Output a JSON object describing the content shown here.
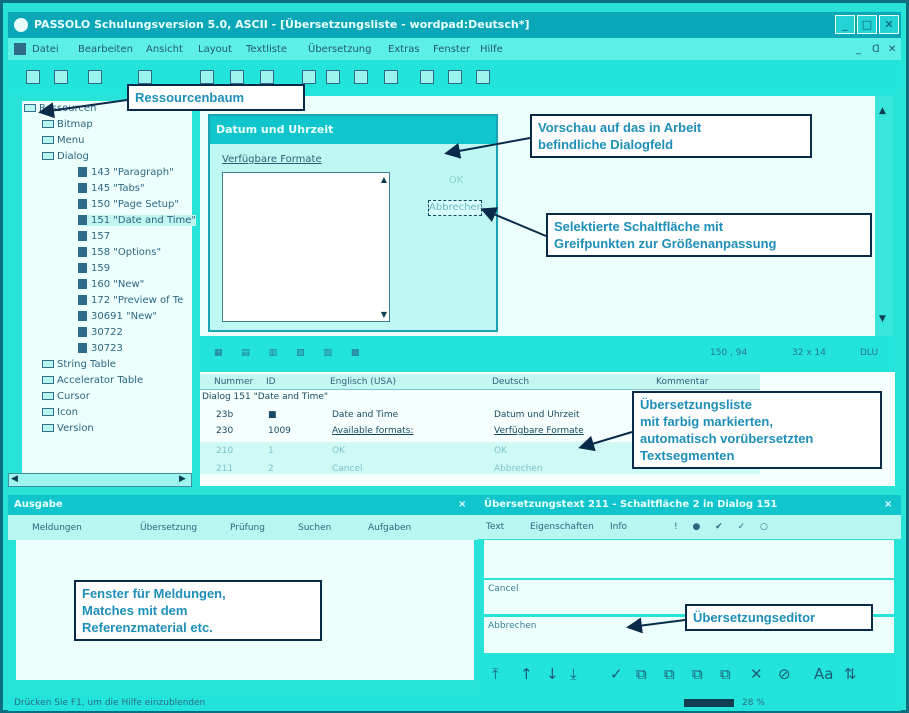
{
  "window": {
    "title": "PASSOLO Schulungsversion 5.0, ASCII - [Übersetzungsliste - wordpad:Deutsch*]"
  },
  "menu": [
    "Datei",
    "Bearbeiten",
    "Ansicht",
    "Layout",
    "Textliste",
    "Übersetzung",
    "Extras",
    "Fenster",
    "Hilfe"
  ],
  "tree": {
    "root": "Ressourcen",
    "items": [
      {
        "label": "Bitmap",
        "icon": "folder-icon"
      },
      {
        "label": "Menu",
        "icon": "folder-icon"
      },
      {
        "label": "Dialog",
        "icon": "folder-icon"
      },
      {
        "label": "143 \"Paragraph\"",
        "icon": "dialog-icon"
      },
      {
        "label": "145 \"Tabs\"",
        "icon": "dialog-icon"
      },
      {
        "label": "150 \"Page Setup\"",
        "icon": "dialog-icon"
      },
      {
        "label": "151 \"Date and Time\"",
        "icon": "dialog-icon"
      },
      {
        "label": "157",
        "icon": "dialog-icon"
      },
      {
        "label": "158 \"Options\"",
        "icon": "dialog-icon"
      },
      {
        "label": "159",
        "icon": "dialog-icon"
      },
      {
        "label": "160 \"New\"",
        "icon": "dialog-icon"
      },
      {
        "label": "172 \"Preview of Te",
        "icon": "dialog-icon"
      },
      {
        "label": "30691 \"New\"",
        "icon": "dialog-icon"
      },
      {
        "label": "30722",
        "icon": "dialog-icon"
      },
      {
        "label": "30723",
        "icon": "dialog-icon"
      },
      {
        "label": "String Table",
        "icon": "folder-icon"
      },
      {
        "label": "Accelerator Table",
        "icon": "folder-icon"
      },
      {
        "label": "Cursor",
        "icon": "folder-icon"
      },
      {
        "label": "Icon",
        "icon": "folder-icon"
      },
      {
        "label": "Version",
        "icon": "folder-icon"
      }
    ]
  },
  "preview": {
    "dialog_title": "Datum und Uhrzeit",
    "formats_label": "Verfügbare Formate",
    "ok_label": "OK",
    "cancel_label": "Abbrechen",
    "status": [
      "150 , 94",
      "32 x 14",
      "DLU"
    ]
  },
  "grid": {
    "headers": [
      "Nummer",
      "ID",
      "Englisch (USA)",
      "Deutsch",
      "Kommentar"
    ],
    "group": "Dialog 151 \"Date and Time\"",
    "rows": [
      {
        "nr": "23b",
        "id": "■",
        "en": "Date and Time",
        "de": "Datum und Uhrzeit"
      },
      {
        "nr": "230",
        "id": "1009",
        "en": "Available formats:",
        "de": "Verfügbare Formate"
      },
      {
        "nr": "210",
        "id": "1",
        "en": "OK",
        "de": "OK"
      },
      {
        "nr": "211",
        "id": "2",
        "en": "Cancel",
        "de": "Abbrechen"
      }
    ]
  },
  "output": {
    "title": "Ausgabe",
    "tabs": [
      "Meldungen",
      "Übersetzung",
      "Prüfung",
      "Suchen",
      "Aufgaben"
    ]
  },
  "editor": {
    "title": "Übersetzungstext 211 - Schaltfläche 2 in Dialog 151",
    "tabs": [
      "Text",
      "Eigenschaften",
      "Info"
    ],
    "original_label": "Cancel",
    "translation_label": "Abbrechen"
  },
  "statusbar": "Drücken Sie F1, um die Hilfe einzublenden",
  "statusbar_right": "28 %",
  "callouts": {
    "resource_tree": "Ressourcenbaum",
    "preview": [
      "Vorschau auf das in Arbeit",
      "befindliche Dialogfeld"
    ],
    "selected": [
      "Selektierte Schaltfläche mit",
      "Greifpunkten zur Größenanpassung"
    ],
    "list": [
      "Übersetzungsliste",
      "mit farbig markierten,",
      "automatisch vorübersetzten",
      "Textsegmenten"
    ],
    "messages": [
      "Fenster für Meldungen,",
      "Matches mit dem",
      "Referenzmaterial etc."
    ],
    "editor": "Übersetzungseditor"
  }
}
